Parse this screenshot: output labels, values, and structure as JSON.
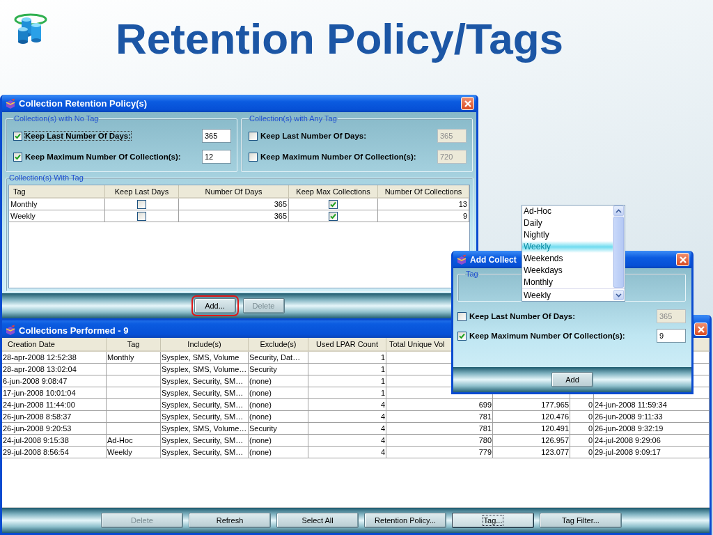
{
  "slide": {
    "title": "Retention Policy/Tags"
  },
  "retention_window": {
    "title": "Collection Retention Policy(s)",
    "no_tag_group": {
      "label": "Collection(s) with No Tag",
      "options": [
        {
          "label": "Keep Last Number Of Days:",
          "checked": true,
          "focused": true,
          "value": "365",
          "disabled": false
        },
        {
          "label": "Keep Maximum Number Of Collection(s):",
          "checked": true,
          "focused": false,
          "value": "12",
          "disabled": false
        }
      ]
    },
    "any_tag_group": {
      "label": "Collection(s) with Any Tag",
      "options": [
        {
          "label": "Keep Last Number Of Days:",
          "checked": false,
          "focused": false,
          "value": "365",
          "disabled": true
        },
        {
          "label": "Keep Maximum Number Of Collection(s):",
          "checked": false,
          "focused": false,
          "value": "720",
          "disabled": true
        }
      ]
    },
    "with_tag_group": {
      "label": "Collection(s) With Tag",
      "columns": [
        "Tag",
        "Keep Last Days",
        "Number Of Days",
        "Keep Max Collections",
        "Number Of Collections"
      ],
      "rows": [
        {
          "tag": "Monthly",
          "keep_last_days": false,
          "number_of_days": "365",
          "keep_max_collections": true,
          "number_of_collections": "13"
        },
        {
          "tag": "Weekly",
          "keep_last_days": false,
          "number_of_days": "365",
          "keep_max_collections": true,
          "number_of_collections": "9"
        }
      ]
    },
    "buttons": [
      {
        "label": "Add...",
        "disabled": false,
        "highlighted": true
      },
      {
        "label": "Delete",
        "disabled": true,
        "highlighted": false
      }
    ]
  },
  "collections_window": {
    "title": "Collections Performed - 9",
    "columns": [
      "Creation Date",
      "Tag",
      "Include(s)",
      "Exclude(s)",
      "Used LPAR Count",
      "Total Unique Vol"
    ],
    "rows": [
      {
        "creation_date": "28-apr-2008 12:52:38",
        "tag": "Monthly",
        "includes": "Sysplex, SMS, Volume",
        "excludes": "Security, Dat…",
        "used_lpar_count": "1"
      },
      {
        "creation_date": "28-apr-2008 13:02:04",
        "includes": "Sysplex, SMS, Volume…",
        "excludes": "Security",
        "used_lpar_count": "1"
      },
      {
        "creation_date": "6-jun-2008 9:08:47",
        "includes": "Sysplex, Security, SM…",
        "excludes": "(none)",
        "used_lpar_count": "1"
      },
      {
        "creation_date": "17-jun-2008 10:01:04",
        "includes": "Sysplex, Security, SM…",
        "excludes": "(none)",
        "used_lpar_count": "1"
      },
      {
        "creation_date": "24-jun-2008 11:44:00",
        "includes": "Sysplex, Security, SM…",
        "excludes": "(none)",
        "used_lpar_count": "4",
        "total_unique_vol": "699",
        "column_7": "177.965",
        "column_8": "0",
        "column_9": "24-jun-2008 11:59:34"
      },
      {
        "creation_date": "26-jun-2008 8:58:37",
        "includes": "Sysplex, Security, SM…",
        "excludes": "(none)",
        "used_lpar_count": "4",
        "total_unique_vol": "781",
        "column_7": "120.476",
        "column_8": "0",
        "column_9": "26-jun-2008 9:11:33"
      },
      {
        "creation_date": "26-jun-2008 9:20:53",
        "includes": "Sysplex, SMS, Volume…",
        "excludes": "Security",
        "used_lpar_count": "4",
        "total_unique_vol": "781",
        "column_7": "120.491",
        "column_8": "0",
        "column_9": "26-jun-2008 9:32:19"
      },
      {
        "creation_date": "24-jul-2008 9:15:38",
        "tag": "Ad-Hoc",
        "includes": "Sysplex, Security, SM…",
        "excludes": "(none)",
        "used_lpar_count": "4",
        "total_unique_vol": "780",
        "column_7": "126.957",
        "column_8": "0",
        "column_9": "24-jul-2008 9:29:06"
      },
      {
        "creation_date": "29-jul-2008 8:56:54",
        "tag": "Weekly",
        "includes": "Sysplex, Security, SM…",
        "excludes": "(none)",
        "used_lpar_count": "4",
        "total_unique_vol": "779",
        "column_7": "123.077",
        "column_8": "0",
        "column_9": "29-jul-2008 9:09:17"
      }
    ],
    "buttons": [
      {
        "label": "Delete",
        "disabled": true,
        "focused": false
      },
      {
        "label": "Refresh",
        "disabled": false,
        "focused": false
      },
      {
        "label": "Select All",
        "disabled": false,
        "focused": false
      },
      {
        "label": "Retention Policy...",
        "disabled": false,
        "focused": false
      },
      {
        "label": "Tag...",
        "disabled": false,
        "focused": true
      },
      {
        "label": "Tag Filter...",
        "disabled": false,
        "focused": false
      }
    ]
  },
  "add_dialog": {
    "title": "Add Collect",
    "tag_group": {
      "label": "Tag",
      "value": "Weekly"
    },
    "options": [
      {
        "label": "Keep Last Number Of Days:",
        "checked": false,
        "value": "365",
        "disabled": true
      },
      {
        "label": "Keep Maximum Number Of Collection(s):",
        "checked": true,
        "value": "9",
        "disabled": false
      }
    ],
    "buttons": [
      {
        "label": "Add"
      }
    ]
  },
  "tag_dropdown": {
    "items": [
      {
        "label": "Ad-Hoc",
        "selected": false
      },
      {
        "label": "Daily",
        "selected": false
      },
      {
        "label": "Nightly",
        "selected": false
      },
      {
        "label": "Weekly",
        "selected": true
      },
      {
        "label": "Weekends",
        "selected": false
      },
      {
        "label": "Weekdays",
        "selected": false
      },
      {
        "label": "Monthly",
        "selected": false
      }
    ]
  }
}
